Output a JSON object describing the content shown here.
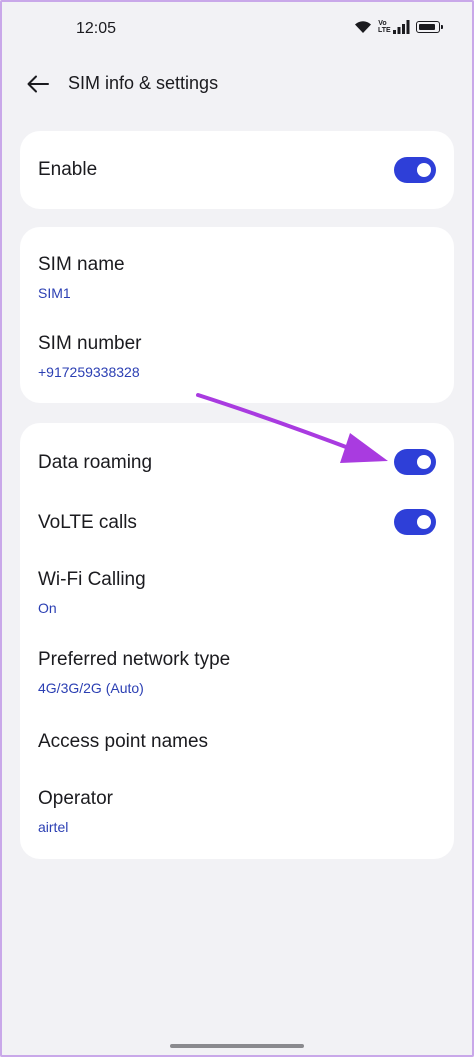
{
  "status_bar": {
    "time": "12:05",
    "volte_badge_top": "Vo",
    "volte_badge_bottom": "LTE",
    "icons": [
      "wifi-icon",
      "volte-icon",
      "signal-icon",
      "battery-icon"
    ]
  },
  "header": {
    "back_icon": "arrow-left-icon",
    "title": "SIM info & settings"
  },
  "enable_card": {
    "enable": {
      "label": "Enable",
      "on": true
    }
  },
  "sim_card": {
    "sim_name": {
      "label": "SIM name",
      "value": "SIM1"
    },
    "sim_number": {
      "label": "SIM number",
      "value": "+917259338328"
    }
  },
  "network_card": {
    "data_roaming": {
      "label": "Data roaming",
      "on": true
    },
    "volte_calls": {
      "label": "VoLTE calls",
      "on": true
    },
    "wifi_calling": {
      "label": "Wi-Fi Calling",
      "value": "On"
    },
    "preferred_network": {
      "label": "Preferred network type",
      "value": "4G/3G/2G (Auto)"
    },
    "apn": {
      "label": "Access point names"
    },
    "operator": {
      "label": "Operator",
      "value": "airtel"
    }
  },
  "colors": {
    "accent": "#2e3fd8",
    "subtitle": "#2b3fb3",
    "annotation_arrow": "#a93be0",
    "background": "#f2f2f5",
    "card": "#ffffff"
  }
}
